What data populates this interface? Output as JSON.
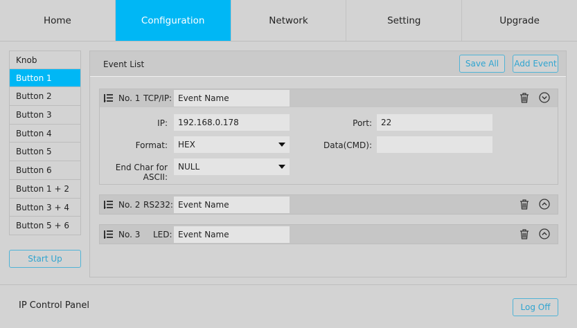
{
  "nav": [
    "Home",
    "Configuration",
    "Network",
    "Setting",
    "Upgrade"
  ],
  "sidebar": {
    "items": [
      "Knob",
      "Button 1",
      "Button 2",
      "Button 3",
      "Button 4",
      "Button 5",
      "Button 6",
      "Button 1 + 2",
      "Button 3 + 4",
      "Button 5 + 6"
    ],
    "startup": "Start Up"
  },
  "panel": {
    "title": "Event List",
    "save_all": "Save All",
    "add_event": "Add Event"
  },
  "events": [
    {
      "no": "No. 1",
      "type": "TCP/IP:",
      "name": "Event Name",
      "expanded": true,
      "ip_label": "IP:",
      "ip": "192.168.0.178",
      "port_label": "Port:",
      "port": "22",
      "format_label": "Format:",
      "format": "HEX",
      "data_label": "Data(CMD):",
      "data": "",
      "endchar_label": "End Char for ASCII:",
      "endchar": "NULL"
    },
    {
      "no": "No. 2",
      "type": "RS232:",
      "name": "Event Name",
      "expanded": false
    },
    {
      "no": "No. 3",
      "type": "LED:",
      "name": "Event Name",
      "expanded": false
    }
  ],
  "footer": {
    "title": "IP Control Panel",
    "logoff": "Log Off"
  }
}
